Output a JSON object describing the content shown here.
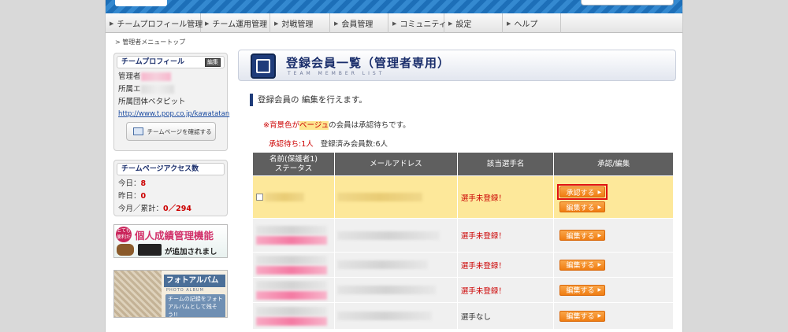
{
  "nav": {
    "items": [
      "チームプロフィール管理",
      "チーム運用管理",
      "対戦管理",
      "会員管理",
      "コミュニティ",
      "設定",
      "ヘルプ"
    ]
  },
  "breadcrumb": "> 管理者メニュートップ",
  "profile": {
    "title": "チームプロフィール",
    "edit_badge": "編集",
    "admin_label": "管理者",
    "area_label": "所属エ",
    "org_label": "所属団体",
    "org_value": "ベタピット",
    "url": "http://www.t.pop.co.jp/kawatatan",
    "check_button": "チームページを確認する"
  },
  "access": {
    "title": "チームページアクセス数",
    "today_label": "今日：",
    "today_value": "8",
    "yesterday_label": "昨日：",
    "yesterday_value": "0",
    "month_label": "今月／累計：",
    "month_value": "0／294"
  },
  "banner1": {
    "tag": "とても便利だ",
    "headline": "個人成績管理機能",
    "sub": "が追加されました!!"
  },
  "banner2": {
    "headline": "フォトアルバム",
    "headline_en": "PHOTO ALBUM",
    "desc": "チームの記録をフォトアルバムとして残そう!!"
  },
  "main": {
    "title": "登録会員一覧（管理者専用）",
    "title_en": "TEAM MEMBER LIST",
    "intro": "登録会員の 編集を行えます。",
    "note_mark": "※背景色が",
    "note_highlight": "ベージュ",
    "note_rest": "の会員は承認待ちです。",
    "pending_count": "承認待ち:1人",
    "registered_count": "登録済み会員数:6人"
  },
  "table": {
    "headers": [
      "名前(保護者1)\nステータス",
      "メールアドレス",
      "該当選手名",
      "承認/編集"
    ],
    "approve_label": "承認する",
    "edit_label": "編集する",
    "rows": [
      {
        "status": "pending",
        "player": "選手未登録！"
      },
      {
        "status": "regular",
        "player": "選手未登録！"
      },
      {
        "status": "regular",
        "player": "選手未登録！"
      },
      {
        "status": "regular",
        "player": "選手未登録！"
      },
      {
        "status": "regular",
        "player": "選手なし"
      }
    ]
  },
  "colors": {
    "brand_blue": "#1f3c7a",
    "pending_bg": "#fde89a",
    "action_orange": "#f07d12",
    "alert_red": "#cc0000"
  }
}
